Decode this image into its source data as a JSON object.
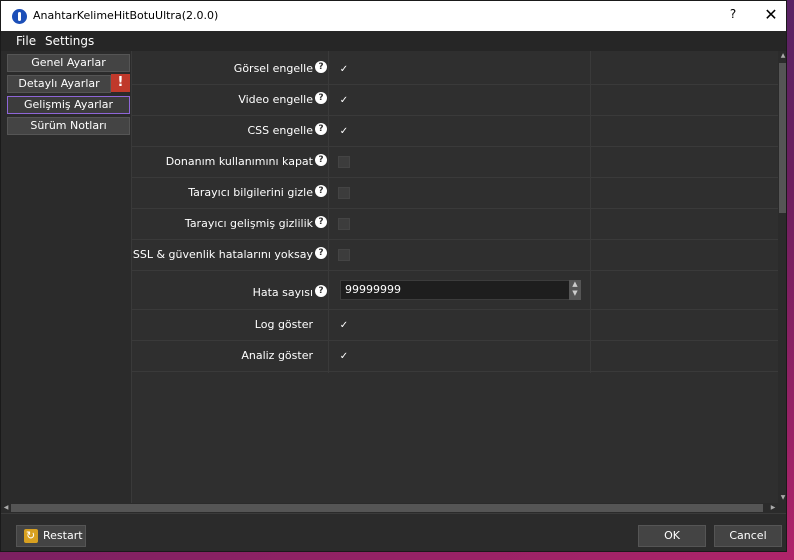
{
  "window": {
    "title": "AnahtarKelimeHitBotuUltra(2.0.0)",
    "help": "?",
    "close": "✕"
  },
  "menu": {
    "file": "File",
    "settings": "Settings"
  },
  "sidebar": {
    "items": [
      {
        "label": "Genel Ayarlar"
      },
      {
        "label": "Detaylı Ayarlar",
        "warning": "!"
      },
      {
        "label": "Gelişmiş Ayarlar"
      },
      {
        "label": "Sürüm Notları"
      }
    ]
  },
  "settings": {
    "rows": [
      {
        "label": "Görsel engelle",
        "checked": true
      },
      {
        "label": "Video engelle",
        "checked": true
      },
      {
        "label": "CSS engelle",
        "checked": true
      },
      {
        "label": "Donanım kullanımını kapat",
        "checked": false
      },
      {
        "label": "Tarayıcı bilgilerini gizle",
        "checked": false
      },
      {
        "label": "Tarayıcı gelişmiş gizlilik",
        "checked": false
      },
      {
        "label": "SSL & güvenlik hatalarını yoksay",
        "checked": false
      },
      {
        "label": "Hata sayısı",
        "value": "99999999"
      },
      {
        "label": "Log göster",
        "checked": true
      },
      {
        "label": "Analiz göster",
        "checked": true
      }
    ],
    "help_glyph": "?",
    "check_glyph": "✓"
  },
  "footer": {
    "restart": "Restart",
    "ok": "OK",
    "cancel": "Cancel"
  },
  "colors": {
    "accent": "#8e66d8",
    "warning": "#c0392b",
    "background": "#2f2f2f"
  }
}
